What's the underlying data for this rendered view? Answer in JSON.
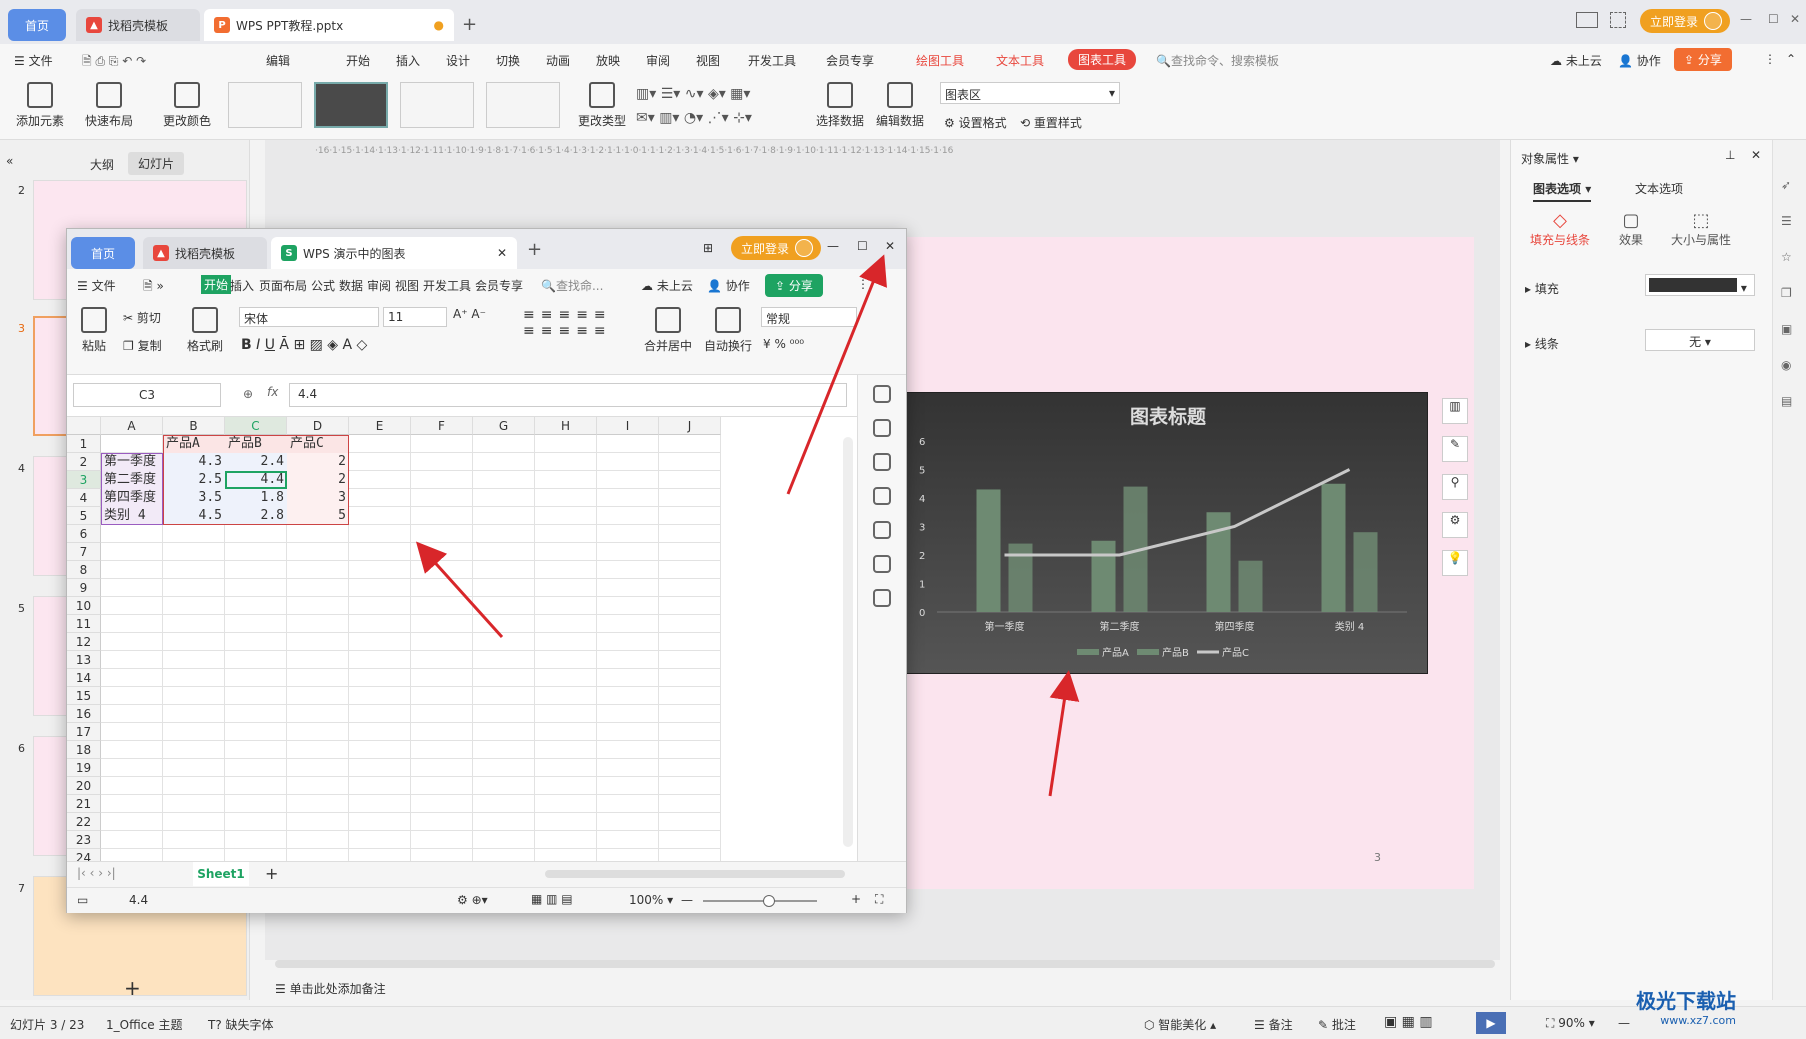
{
  "titlebar": {
    "home": "首页",
    "tab1": "找稻壳模板",
    "tab2": "WPS PPT教程.pptx",
    "login": "立即登录"
  },
  "menubar": {
    "file": "文件",
    "edit": "编辑",
    "items": [
      "开始",
      "插入",
      "设计",
      "切换",
      "动画",
      "放映",
      "审阅",
      "视图",
      "开发工具",
      "会员专享"
    ],
    "tool1": "绘图工具",
    "tool2": "文本工具",
    "tool3": "图表工具",
    "search": "查找命令、搜索模板",
    "cloud": "未上云",
    "collab": "协作",
    "share": "分享"
  },
  "ribbon": {
    "add_element": "添加元素",
    "quick_layout": "快速布局",
    "change_color": "更改颜色",
    "change_type": "更改类型",
    "select_data": "选择数据",
    "edit_data": "编辑数据",
    "area_dropdown": "图表区",
    "set_format": "设置格式",
    "reset_style": "重置样式"
  },
  "leftpanel": {
    "outline": "大纲",
    "slides": "幻灯片",
    "slide_nums": [
      "2",
      "3",
      "4",
      "5",
      "6",
      "7"
    ],
    "star": "★"
  },
  "ruler": "·16·1·15·1·14·1·13·1·12·1·11·1·10·1·9·1·8·1·7·1·6·1·5·1·4·1·3·1·2·1·1·1·0·1·1·1·2·1·3·1·4·1·5·1·6·1·7·1·8·1·9·1·10·1·11·1·12·1·13·1·14·1·15·1·16",
  "canvas": {
    "page_number": "3",
    "notes": "单击此处添加备注"
  },
  "chart_data": {
    "type": "bar",
    "title": "图表标题",
    "categories": [
      "第一季度",
      "第二季度",
      "第四季度",
      "类别 4"
    ],
    "series": [
      {
        "name": "产品A",
        "type": "bar",
        "values": [
          4.3,
          2.5,
          3.5,
          4.5
        ]
      },
      {
        "name": "产品B",
        "type": "bar",
        "values": [
          2.4,
          4.4,
          1.8,
          2.8
        ]
      },
      {
        "name": "产品C",
        "type": "line",
        "values": [
          2,
          2,
          3,
          5
        ]
      }
    ],
    "ylim": [
      0,
      6
    ],
    "yticks": [
      "0",
      "1",
      "2",
      "3",
      "4",
      "5",
      "6"
    ],
    "legend": "bottom",
    "colors": {
      "bar": "#6e8a72",
      "line": "#c8c8c8"
    }
  },
  "rightpanel": {
    "title": "对象属性",
    "tab1": "图表选项",
    "tab2": "文本选项",
    "sub1": "填充与线条",
    "sub2": "效果",
    "sub3": "大小与属性",
    "fill": "填充",
    "line": "线条",
    "line_value": "无"
  },
  "statusbar": {
    "slide": "幻灯片 3 / 23",
    "theme": "1_Office 主题",
    "font": "缺失字体",
    "beautify": "智能美化",
    "notes": "备注",
    "comment": "批注",
    "zoom": "90%",
    "watermark": "极光下载站",
    "watermark_url": "www.xz7.com"
  },
  "ss": {
    "home": "首页",
    "tab1": "找稻壳模板",
    "tab2": "WPS 演示中的图表",
    "login": "立即登录",
    "menu": {
      "file": "文件",
      "start": "开始",
      "items": [
        "插入",
        "页面布局",
        "公式",
        "数据",
        "审阅",
        "视图",
        "开发工具",
        "会员专享"
      ],
      "search": "查找命...",
      "cloud": "未上云",
      "collab": "协作",
      "share": "分享"
    },
    "ribbon": {
      "paste": "粘贴",
      "cut": "剪切",
      "copy": "复制",
      "format_painter": "格式刷",
      "font": "宋体",
      "size": "11",
      "merge": "合并居中",
      "wrap": "自动换行",
      "numfmt": "常规",
      "bold": "B",
      "italic": "I",
      "underline": "U"
    },
    "cellref": "C3",
    "fx": "fx",
    "formula": "4.4",
    "columns": [
      "A",
      "B",
      "C",
      "D",
      "E",
      "F",
      "G",
      "H",
      "I",
      "J"
    ],
    "rows": [
      "1",
      "2",
      "3",
      "4",
      "5",
      "6",
      "7",
      "8",
      "9",
      "10",
      "11",
      "12",
      "13",
      "14",
      "15",
      "16",
      "17",
      "18",
      "19",
      "20",
      "21",
      "22",
      "23",
      "24"
    ],
    "header_row": [
      "产品A",
      "产品B",
      "产品C"
    ],
    "data": [
      [
        "第一季度",
        "4.3",
        "2.4",
        "2"
      ],
      [
        "第二季度",
        "2.5",
        "4.4",
        "2"
      ],
      [
        "第四季度",
        "3.5",
        "1.8",
        "3"
      ],
      [
        "类别 4",
        "4.5",
        "2.8",
        "5"
      ]
    ],
    "sheet": "Sheet1",
    "status_value": "4.4",
    "zoom": "100%"
  }
}
